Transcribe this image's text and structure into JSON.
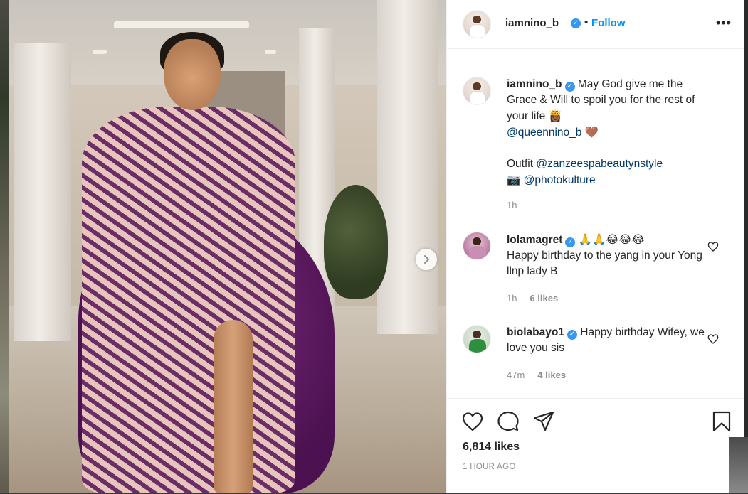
{
  "post": {
    "username": "iamnino_b",
    "verified_mark": "✓",
    "separator": "•",
    "follow_label": "Follow",
    "more_label": "•••",
    "next_arrow": "›"
  },
  "caption": {
    "username": "iamnino_b",
    "text_line1": "May God give me the Grace & Will to spoil you for the rest of your life",
    "emoji1": "👸🏾",
    "mention1": "@queennino_b",
    "emoji2": "🤎",
    "outfit_label": "Outfit",
    "mention2": "@zanzeespabeautynstyle",
    "camera_emoji": "📷",
    "mention3": "@photokulture",
    "time": "1h"
  },
  "comments": [
    {
      "username": "lolamagret",
      "emojis": "🙏🙏😂😂😂",
      "text": "Happy birthday to the yang in your Yong llnp lady B",
      "time": "1h",
      "likes": "6 likes"
    },
    {
      "username": "biolabayo1",
      "text": "Happy birthday Wifey, we love you sis",
      "time": "47m",
      "likes": "4 likes"
    }
  ],
  "footer": {
    "likes": "6,814 likes",
    "posted": "1 HOUR AGO"
  },
  "icons": {
    "like": "heart-icon",
    "comment": "comment-icon",
    "share": "share-icon",
    "save": "bookmark-icon",
    "more": "more-options-icon",
    "next": "chevron-right-icon"
  },
  "colors": {
    "accent": "#0095f6",
    "verified": "#3897f0",
    "mention": "#00376b",
    "muted": "#8e8e8e"
  }
}
